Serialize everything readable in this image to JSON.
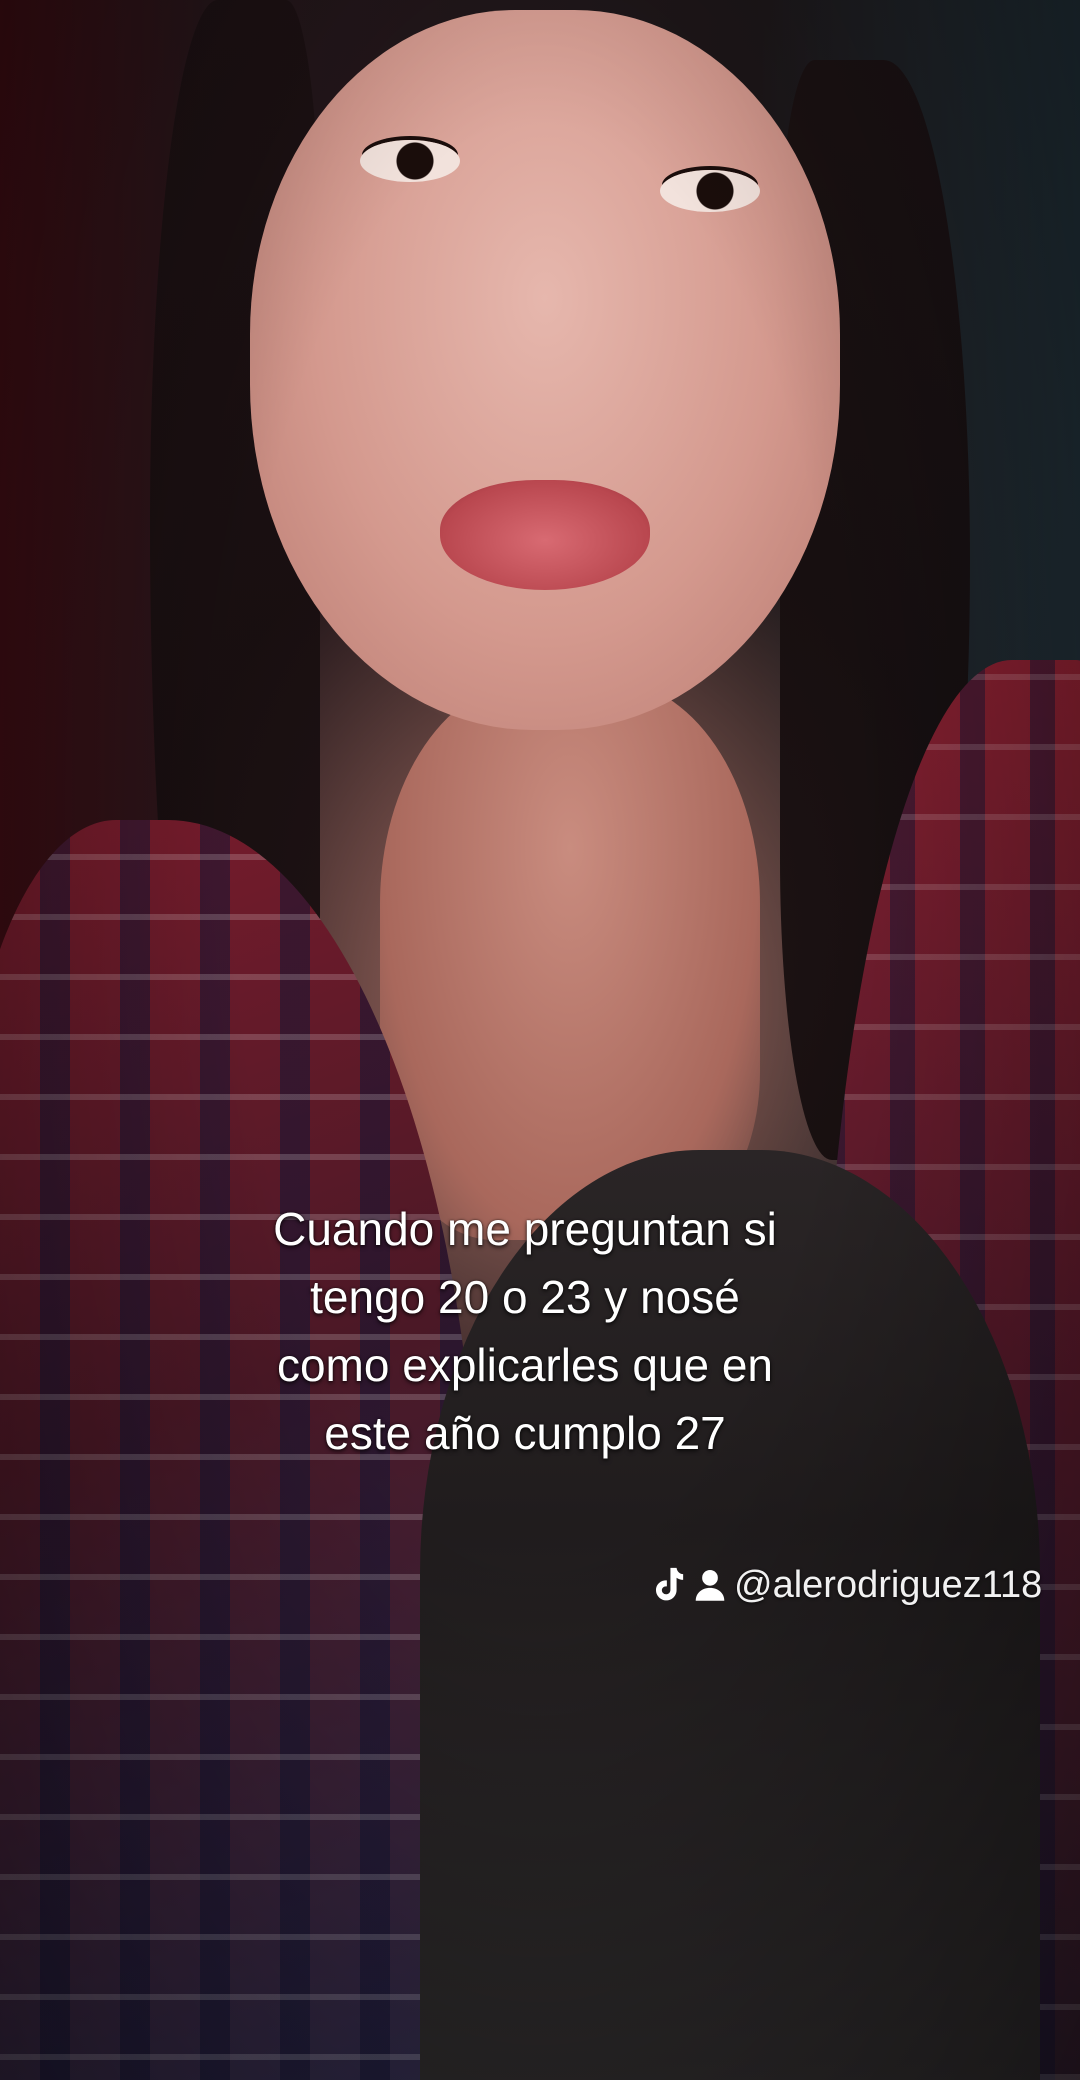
{
  "caption": {
    "lines": [
      "Cuando me preguntan si",
      "tengo 20 o 23 y nosé",
      "como explicarles que en",
      "este año cumplo 27"
    ]
  },
  "watermark": {
    "logo_icon": "tiktok-logo-icon",
    "profile_icon": "person-icon",
    "username": "@alerodriguez118"
  }
}
